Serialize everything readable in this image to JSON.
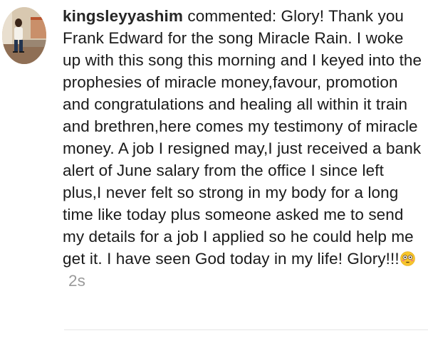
{
  "comment": {
    "username": "kingsleyyashim",
    "action": "commented:",
    "text": "Glory! Thank you Frank Edward for the song Miracle Rain. I woke up with this song this morning and I keyed into the prophesies of miracle money,favour, promotion and congratulations and healing all within it train and brethren,here comes my testimony of miracle money. A job I resigned may,I just received a bank alert of June salary from the office I since left plus,I never felt so strong in my body for a long time like today plus someone asked me to send my details for a job I applied so he could help me get it. I have seen God today in my life! Glory!!!",
    "emoji": "flushed-face-emoji",
    "timestamp": "2s"
  },
  "colors": {
    "username": "#262626",
    "text": "#1a1a1a",
    "timestamp": "#9a9a9a",
    "divider": "#e6e6e6",
    "emoji_face": "#f7c52b"
  }
}
